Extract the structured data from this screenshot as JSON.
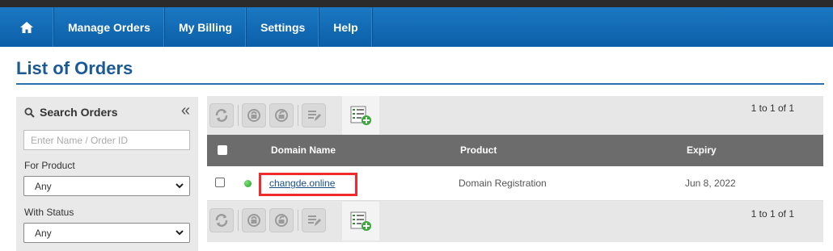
{
  "nav": {
    "home_icon": "home-icon",
    "items": [
      {
        "label": "Manage Orders"
      },
      {
        "label": "My Billing"
      },
      {
        "label": "Settings"
      },
      {
        "label": "Help"
      }
    ]
  },
  "page": {
    "title": "List of Orders"
  },
  "search": {
    "title": "Search Orders",
    "collapse_glyph": "«",
    "name_placeholder": "Enter Name / Order ID",
    "product_label": "For Product",
    "product_value": "Any",
    "status_label": "With Status",
    "status_value": "Any"
  },
  "toolbar": {
    "buttons": [
      "refresh-icon",
      "lock-icon",
      "unlock-icon",
      "edit-list-icon"
    ],
    "add_icon": "add-order-icon",
    "pager_top": "1 to 1 of 1",
    "pager_bottom": "1 to 1 of 1"
  },
  "table": {
    "columns": [
      "Domain Name",
      "Product",
      "Expiry"
    ],
    "rows": [
      {
        "status": "active",
        "status_color": "#22a822",
        "domain": "changde.online",
        "product": "Domain Registration",
        "expiry": "Jun 8, 2022"
      }
    ]
  },
  "colors": {
    "nav": "#0f66ae",
    "title": "#1b5a96",
    "highlight": "#ef2b2b",
    "header": "#6c6c6c"
  }
}
